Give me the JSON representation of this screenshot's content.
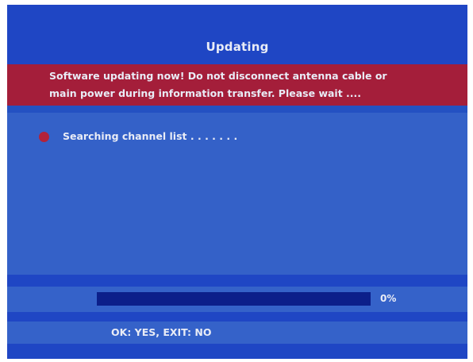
{
  "dialog": {
    "title": "Updating",
    "warning_lines": [
      "Software updating now! Do not disconnect antenna cable or",
      "main power during information transfer. Please wait ...."
    ]
  },
  "status": {
    "text": "Searching channel list . . . .  . . ."
  },
  "progress": {
    "value_percent": 0,
    "label": "0%"
  },
  "footer": {
    "hint": "OK: YES, EXIT: NO"
  },
  "colors": {
    "background_blue": "#2f5cc4",
    "band_blue": "#1f46c4",
    "warning_red": "#a41e3a",
    "progress_track": "#0c1f8a",
    "status_dot": "#b3223a",
    "text": "#e9ecf6"
  }
}
